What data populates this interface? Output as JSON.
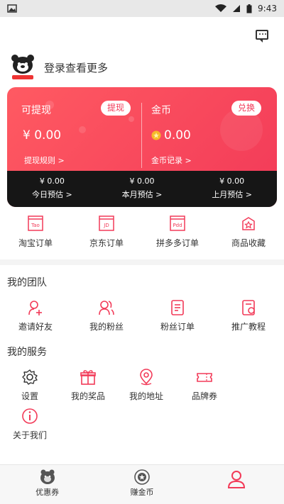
{
  "status_bar": {
    "time": "9:43"
  },
  "header": {
    "login_prompt": "登录查看更多"
  },
  "card": {
    "withdraw": {
      "title": "可提现",
      "button": "提现",
      "amount": "¥ 0.00",
      "rules": "提现规则 >"
    },
    "coins": {
      "title": "金币",
      "button": "兑换",
      "amount": "0.00",
      "records": "金币记录 >"
    },
    "estimates": [
      {
        "value": "¥ 0.00",
        "label": "今日预估 >"
      },
      {
        "value": "¥ 0.00",
        "label": "本月预估 >"
      },
      {
        "value": "¥ 0.00",
        "label": "上月预估 >"
      }
    ]
  },
  "orders": [
    {
      "label": "淘宝订单",
      "icon": "taobao-order-icon",
      "badge": "Tao"
    },
    {
      "label": "京东订单",
      "icon": "jd-order-icon",
      "badge": "JD"
    },
    {
      "label": "拼多多订单",
      "icon": "pdd-order-icon",
      "badge": "Pdd"
    },
    {
      "label": "商品收藏",
      "icon": "favorite-icon"
    }
  ],
  "team": {
    "title": "我的团队",
    "items": [
      {
        "label": "邀请好友",
        "icon": "invite-icon"
      },
      {
        "label": "我的粉丝",
        "icon": "fans-icon"
      },
      {
        "label": "粉丝订单",
        "icon": "fan-orders-icon"
      },
      {
        "label": "推广教程",
        "icon": "tutorial-icon"
      }
    ]
  },
  "services": {
    "title": "我的服务",
    "items": [
      {
        "label": "设置",
        "icon": "settings-icon"
      },
      {
        "label": "我的奖品",
        "icon": "gift-icon"
      },
      {
        "label": "我的地址",
        "icon": "location-icon"
      },
      {
        "label": "品牌券",
        "icon": "coupon-icon"
      },
      {
        "label": "关于我们",
        "icon": "info-icon"
      }
    ]
  },
  "nav": [
    {
      "label": "优惠券",
      "icon": "coupon-tab-icon"
    },
    {
      "label": "赚金币",
      "icon": "coin-tab-icon"
    },
    {
      "label": "",
      "icon": "profile-tab-icon"
    }
  ],
  "colors": {
    "accent": "#f23a58",
    "dark": "#161616",
    "gold": "#f6b82a"
  }
}
